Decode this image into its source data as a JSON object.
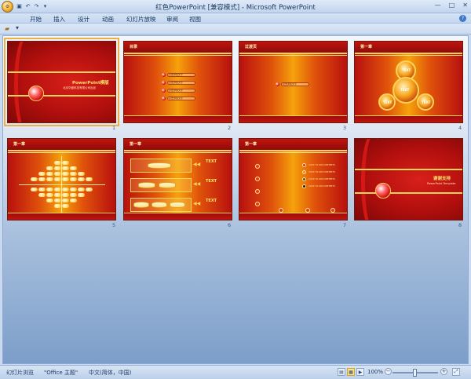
{
  "window": {
    "title": "红色PowerPoint [兼容模式] - Microsoft PowerPoint",
    "minimize": "—",
    "maximize": "□",
    "close": "✕"
  },
  "office_button": {
    "icon": "office-logo-icon"
  },
  "quick_access": {
    "items": [
      "save-icon",
      "undo-icon",
      "redo-icon",
      "customize-icon"
    ]
  },
  "ribbon": {
    "tabs": [
      "开始",
      "插入",
      "设计",
      "动画",
      "幻灯片放映",
      "审阅",
      "视图"
    ],
    "help_icon": "?"
  },
  "mini_toolbar": {
    "icon": "folder-icon",
    "dropdown": "▾"
  },
  "slides": [
    {
      "num": "1",
      "title": "PowerPoint模版",
      "subtitle": "北京华盛科技有限公司出品",
      "selected": true
    },
    {
      "num": "2",
      "title": "目录",
      "items": [
        "点击添加文字",
        "点击添加文字",
        "点击添加文字",
        "点击添加文字"
      ]
    },
    {
      "num": "3",
      "title": "过渡页",
      "items": [
        "点击添加文字"
      ]
    },
    {
      "num": "4",
      "title": "第一章",
      "labels": [
        "TEXT",
        "TEXT",
        "TEXT",
        "TEXT"
      ]
    },
    {
      "num": "5",
      "title": "第一章"
    },
    {
      "num": "6",
      "title": "第一章",
      "labels": [
        "TEXT",
        "TEXT",
        "TEXT"
      ]
    },
    {
      "num": "7",
      "title": "第一章",
      "legend": [
        "CLICK TO ADD CONTENTS",
        "CLICK TO ADD CONTENTS",
        "CLICK TO ADD CONTENTS",
        "CLICK TO ADD CONTENTS"
      ]
    },
    {
      "num": "8",
      "title": "谢谢支持",
      "subtitle": "PowerPoint Template"
    }
  ],
  "statusbar": {
    "view_label": "幻灯片浏览",
    "theme": "\"Office 主题\"",
    "language": "中文(简体，中国)",
    "zoom": "100%",
    "zoom_fraction": 0.5
  }
}
